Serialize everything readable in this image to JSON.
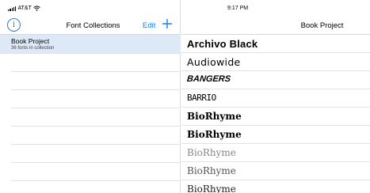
{
  "status_bar": {
    "carrier": "AT&T",
    "time": "9:17 PM"
  },
  "sidebar": {
    "title": "Font Collections",
    "info_label": "i",
    "edit_label": "Edit",
    "collections": [
      {
        "name": "Book Project",
        "subtitle": "36 fonts in collection"
      }
    ]
  },
  "detail": {
    "title": "Book Project",
    "fonts": [
      "Archivo Black",
      "Audiowide",
      "BANGERS",
      "BARRIO",
      "BioRhyme",
      "BioRhyme",
      "BioRhyme",
      "BioRhyme",
      "BioRhyme"
    ]
  },
  "colors": {
    "accent": "#1a7cf5",
    "selected_row": "#dde9f6"
  }
}
